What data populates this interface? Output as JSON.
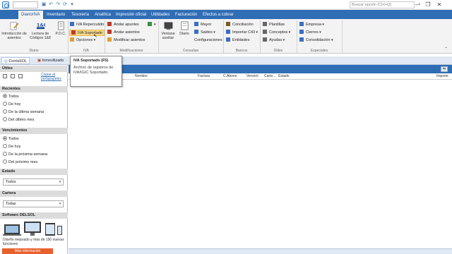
{
  "titlebar": {
    "company_value": "",
    "search_placeholder": "Buscar opción (Ctrl+Q)",
    "window_controls": [
      "?",
      "–",
      "❐",
      "✕"
    ]
  },
  "tabs": [
    {
      "label": "Diario/IVA",
      "active": true
    },
    {
      "label": "Inventario"
    },
    {
      "label": "Tesorería"
    },
    {
      "label": "Analítica"
    },
    {
      "label": "Impresión oficial"
    },
    {
      "label": "Utilidades"
    },
    {
      "label": "Facturación"
    },
    {
      "label": "Efectos a cobrar"
    }
  ],
  "ribbon": {
    "diario": {
      "group_label": "Diario",
      "intro_label": "Introducción de asientos",
      "lectura_label": "Lectura de Códigos 1&8",
      "poc_label": "P.O.C."
    },
    "iva": {
      "group_label": "IVA",
      "repercutido": "IVA Repercutido",
      "soportado": "IVA Soportado",
      "opciones": "Opciones"
    },
    "modificaciones": {
      "group_label": "Modificaciones",
      "andar_apuntes": "Andar apuntes",
      "andar_asientos": "Andar asientos",
      "modificar_asientos": "Modificar asientos"
    },
    "consultas": {
      "group_label": "Consultas",
      "ventana_auxiliar": "Ventana auxiliar",
      "diario": "Diario",
      "mayor": "Mayor",
      "saldos": "Saldos",
      "configuraciones": "Configuraciones"
    },
    "bancos": {
      "group_label": "Bancos",
      "conciliacion": "Conciliación",
      "importar_c43": "Importar C43",
      "entidades": "Entidades"
    },
    "utiles": {
      "group_label": "Útiles",
      "plantillas": "Plantillas",
      "conceptos": "Conceptos",
      "ayudas": "Ayudas"
    },
    "especiales": {
      "group_label": "Especiales",
      "empresa": "Empresa",
      "cierres": "Cierres",
      "consolidacion": "Consolidación"
    }
  },
  "tooltip": {
    "title": "IVA Soportado (F5)",
    "body": "Archivo de registros de IVA/IGIC Soportado."
  },
  "doc_tabs": [
    "ContaSOL",
    "Inmovilizado"
  ],
  "left_panel": {
    "utiles": {
      "title": "Útiles",
      "link": "Copiar al portapapeles"
    },
    "recientes": {
      "title": "Recientes",
      "options": [
        "Todos",
        "De hoy",
        "De la última semana",
        "Del último mes"
      ],
      "selected_index": 0
    },
    "vencimientos": {
      "title": "Vencimientos",
      "options": [
        "Todos",
        "De hoy",
        "De la próxima semana",
        "Del próximo mes"
      ],
      "selected_index": 0
    },
    "estado": {
      "title": "Estado",
      "value": "Todos"
    },
    "cartera": {
      "title": "Cartera",
      "value": "Todas"
    },
    "promo": {
      "title": "Software DELSOL",
      "text": "Diseño mejorado y más de 150 nuevas funciones",
      "button": "Más información"
    }
  },
  "grid": {
    "columns": [
      "Nombre",
      "Factura",
      "C.Abono",
      "Vencim.",
      "Carte...",
      "Estado",
      "Importe"
    ]
  },
  "colors": {
    "accent": "#2f6db5",
    "ribbon_bg": "#f3f3f3",
    "highlight": "#f8d98a",
    "promo": "#e8602c"
  }
}
